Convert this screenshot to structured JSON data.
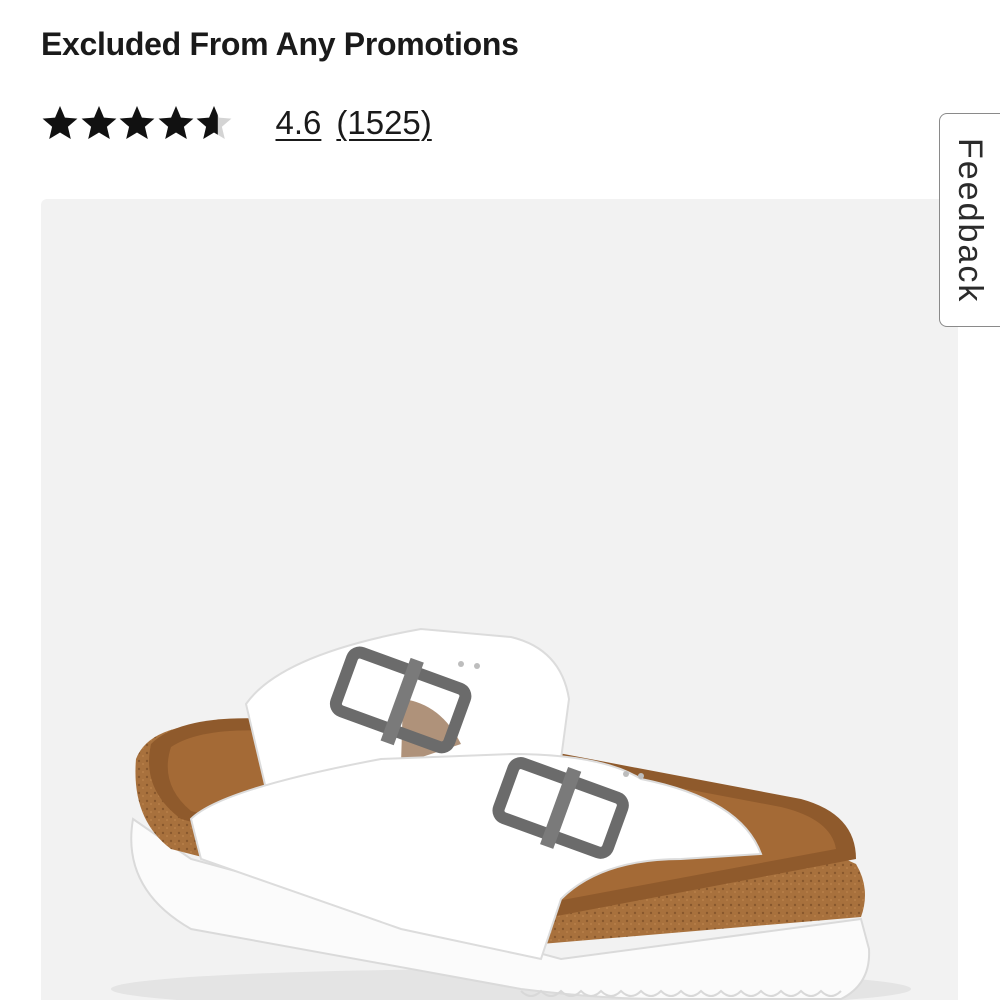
{
  "product": {
    "promo_note": "Excluded From Any Promotions"
  },
  "rating": {
    "stars_value": 4.6,
    "stars_max": 5,
    "value_text": "4.6",
    "count_text": "(1525)"
  },
  "image": {
    "alt": "White double-strap sandal with cork footbed"
  },
  "feedback": {
    "label": "Feedback"
  },
  "colors": {
    "star_filled": "#111111",
    "star_empty": "#d4d4d4",
    "image_bg": "#f2f2f2",
    "text": "#1a1a1a"
  }
}
